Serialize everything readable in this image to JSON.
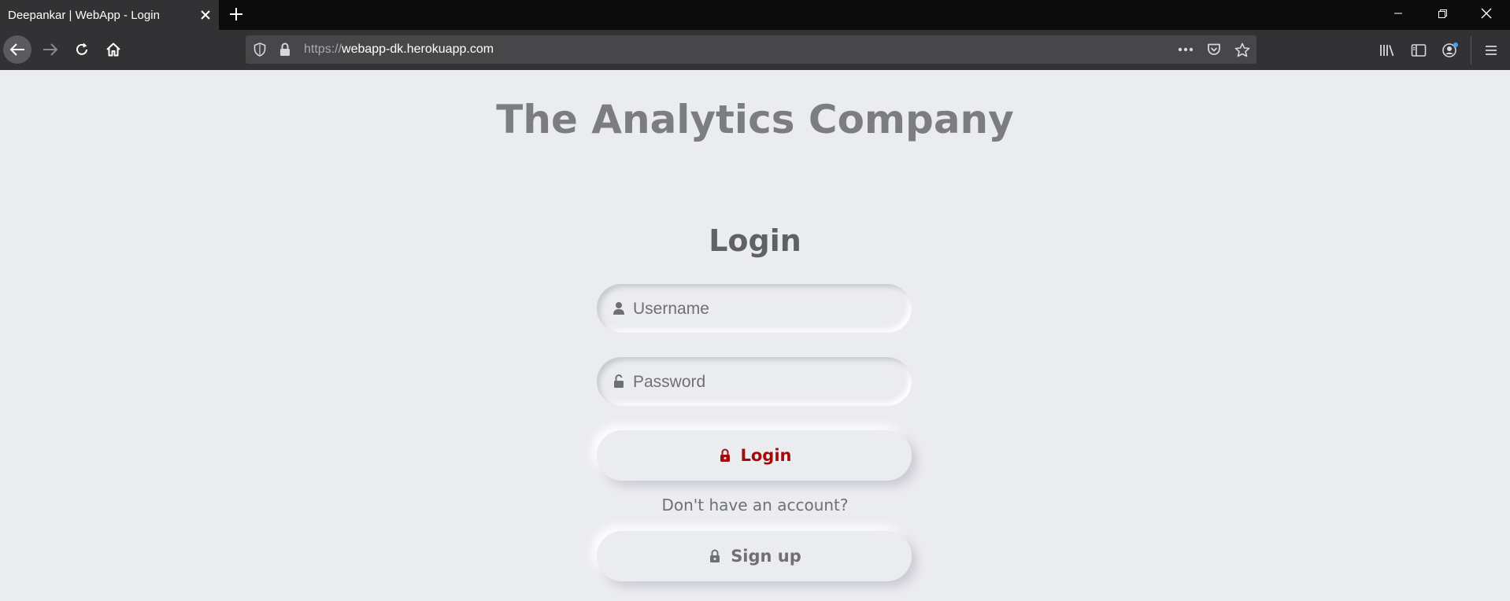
{
  "browser": {
    "tab": {
      "title": "Deepankar | WebApp - Login"
    },
    "url": {
      "protocol": "https://",
      "host": "webapp-dk.herokuapp.com"
    }
  },
  "page": {
    "company_title": "The Analytics Company",
    "login_heading": "Login",
    "username_placeholder": "Username",
    "password_placeholder": "Password",
    "login_button_label": "Login",
    "no_account_text": "Don't have an account?",
    "signup_button_label": "Sign up"
  },
  "colors": {
    "background": "#ebecf0",
    "login_accent": "#a30b0b",
    "muted_text": "#6f7075"
  },
  "icons": {
    "username_field": "user-icon",
    "password_field": "unlock-icon",
    "login_button": "lock-icon",
    "signup_button": "lock-icon"
  }
}
